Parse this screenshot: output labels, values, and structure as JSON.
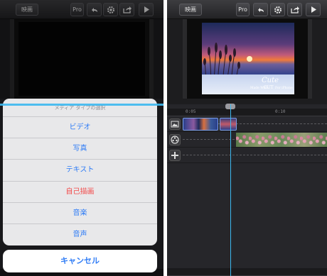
{
  "left": {
    "toolbar": {
      "back_label": "映画",
      "pro_label": "Pro"
    },
    "action_sheet": {
      "title": "メディア タイプの選択",
      "items": [
        "ビデオ",
        "写真",
        "テキスト",
        "自己描画",
        "音楽",
        "音声"
      ],
      "destructive_index": 3,
      "cancel_label": "キャンセル"
    }
  },
  "right": {
    "toolbar": {
      "back_label": "映画",
      "pro_label": "Pro"
    },
    "video": {
      "caption_script": "Cute",
      "caption_brand": "CUT",
      "made_with": "Made With",
      "for_iphone": "For iPhone"
    },
    "timeline": {
      "ruler_labels": [
        "0:05",
        "0:10"
      ],
      "track_buttons": [
        "image-track-icon",
        "film-track-icon",
        "add-track-icon"
      ]
    }
  },
  "colors": {
    "accent_blue": "#2f7cf6",
    "destructive_red": "#f24a4a",
    "playhead": "#3db8f0"
  },
  "icons": [
    "undo-icon",
    "gear-icon",
    "share-icon",
    "play-icon"
  ]
}
